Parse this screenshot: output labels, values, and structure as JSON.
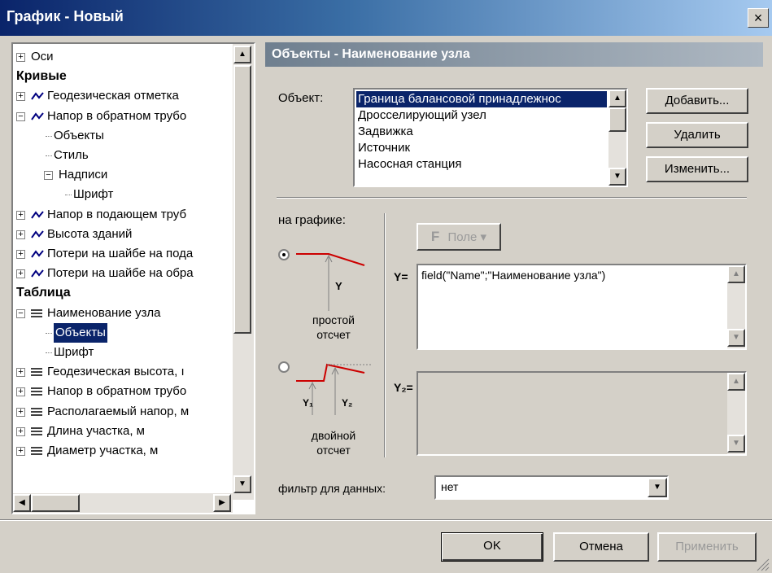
{
  "window": {
    "title": "График - Новый",
    "close": "×"
  },
  "tree": {
    "items": [
      {
        "label": "Оси",
        "type": "node",
        "expander": "+"
      },
      {
        "label": "Кривые",
        "type": "header"
      },
      {
        "label": "Геодезическая отметка",
        "type": "curve",
        "expander": "+"
      },
      {
        "label": "Напор в обратном трубо",
        "type": "curve",
        "expander": "−"
      },
      {
        "label": "Объекты",
        "type": "leaf"
      },
      {
        "label": "Стиль",
        "type": "leaf"
      },
      {
        "label": "Надписи",
        "type": "node",
        "expander": "−"
      },
      {
        "label": "Шрифт",
        "type": "leaf"
      },
      {
        "label": "Напор в подающем труб",
        "type": "curve",
        "expander": "+"
      },
      {
        "label": "Высота зданий",
        "type": "curve",
        "expander": "+"
      },
      {
        "label": "Потери на шайбе на пода",
        "type": "curve",
        "expander": "+"
      },
      {
        "label": "Потери на шайбе на обра",
        "type": "curve",
        "expander": "+"
      },
      {
        "label": "Таблица",
        "type": "header"
      },
      {
        "label": "Наименование узла",
        "type": "table",
        "expander": "−"
      },
      {
        "label": "Объекты",
        "type": "leaf",
        "selected": true
      },
      {
        "label": "Шрифт",
        "type": "leaf"
      },
      {
        "label": "Геодезическая высота, ı",
        "type": "table",
        "expander": "+"
      },
      {
        "label": "Напор в обратном трубо",
        "type": "table",
        "expander": "+"
      },
      {
        "label": "Располагаемый напор, м",
        "type": "table",
        "expander": "+"
      },
      {
        "label": "Длина участка, м",
        "type": "table",
        "expander": "+"
      },
      {
        "label": "Диаметр участка, м",
        "type": "table",
        "expander": "+"
      }
    ]
  },
  "panel": {
    "header": "Объекты - Наименование узла",
    "object_label": "Объект:",
    "object_list": [
      "Граница балансовой принадлежнос",
      "Дросселирующий узел",
      "Задвижка",
      "Источник",
      "Насосная станция"
    ],
    "object_selected_index": 0,
    "buttons": {
      "add": "Добавить...",
      "delete": "Удалить",
      "edit": "Изменить..."
    },
    "on_chart_label": "на графике:",
    "mode_simple": {
      "label_line1": "простой",
      "label_line2": "отсчет",
      "y": "Y"
    },
    "mode_double": {
      "label_line1": "двойной",
      "label_line2": "отсчет",
      "y1": "Y₁",
      "y2": "Y₂"
    },
    "selected_mode": "simple",
    "field_button": {
      "icon": "F",
      "label": "Поле",
      "arrow": "▾"
    },
    "y_label": "Y=",
    "y_value": "field(\"Name\";\"Наименование узла\")",
    "y2_label": "Y₂=",
    "y2_value": "",
    "filter_label": "фильтр для данных:",
    "filter_value": "нет"
  },
  "footer": {
    "ok": "OK",
    "cancel": "Отмена",
    "apply": "Применить"
  },
  "colors": {
    "title_start": "#0a246a",
    "selection": "#0a246a",
    "red_line": "#cc0000"
  }
}
